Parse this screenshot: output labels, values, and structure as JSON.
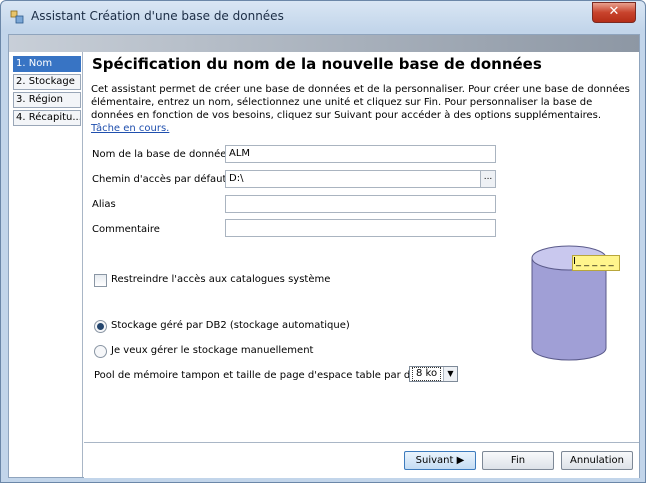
{
  "window": {
    "title": "Assistant Création d'une base de données",
    "close_glyph": "✕",
    "icon": "wizard-app-icon"
  },
  "nav": {
    "items": [
      {
        "label": "1. Nom",
        "active": true
      },
      {
        "label": "2. Stockage",
        "active": false
      },
      {
        "label": "3. Région",
        "active": false
      },
      {
        "label": "4. Récapitu...",
        "active": false
      }
    ]
  },
  "page": {
    "heading": "Spécification du nom de la nouvelle base de données",
    "intro": "Cet assistant permet de créer une base de données et de la personnaliser. Pour créer une base de données élémentaire, entrez un nom, sélectionnez une unité et cliquez sur Fin. Pour personnaliser la base de données en fonction de vos besoins, cliquez sur Suivant pour accéder à des options supplémentaires.",
    "intro_link": "Tâche en cours."
  },
  "form": {
    "db_name_label": "Nom de la base de données",
    "db_name_value": "ALM",
    "path_label": "Chemin d'accès par défaut",
    "path_value": "D:\\",
    "browse_label": "...",
    "alias_label": "Alias",
    "alias_value": "",
    "comment_label": "Commentaire",
    "comment_value": "",
    "restrict_label": "Restreindre l'accès aux catalogues système",
    "restrict_checked": false,
    "storage_auto_label": "Stockage géré par DB2 (stockage automatique)",
    "storage_auto_selected": true,
    "storage_manual_label": "Je veux gérer le stockage manuellement",
    "storage_manual_selected": false,
    "bufferpool_label": "Pool de mémoire tampon et taille de page d'espace table par défaut",
    "bufferpool_value": "8 ko"
  },
  "illustration": {
    "icon": "database-cylinder-icon",
    "tooltip_text": "I_ _ _ _ _",
    "colors": {
      "cylinder_top": "#c9c8ee",
      "cylinder_body": "#a09fd6",
      "tooltip_bg": "#fff58c"
    }
  },
  "buttons": {
    "next": "Suivant",
    "finish": "Fin",
    "cancel": "Annulation"
  },
  "colors": {
    "accent": "#3874c4",
    "titlebar": "#c2d5ea",
    "close": "#c8432c",
    "link": "#1f4fae"
  }
}
